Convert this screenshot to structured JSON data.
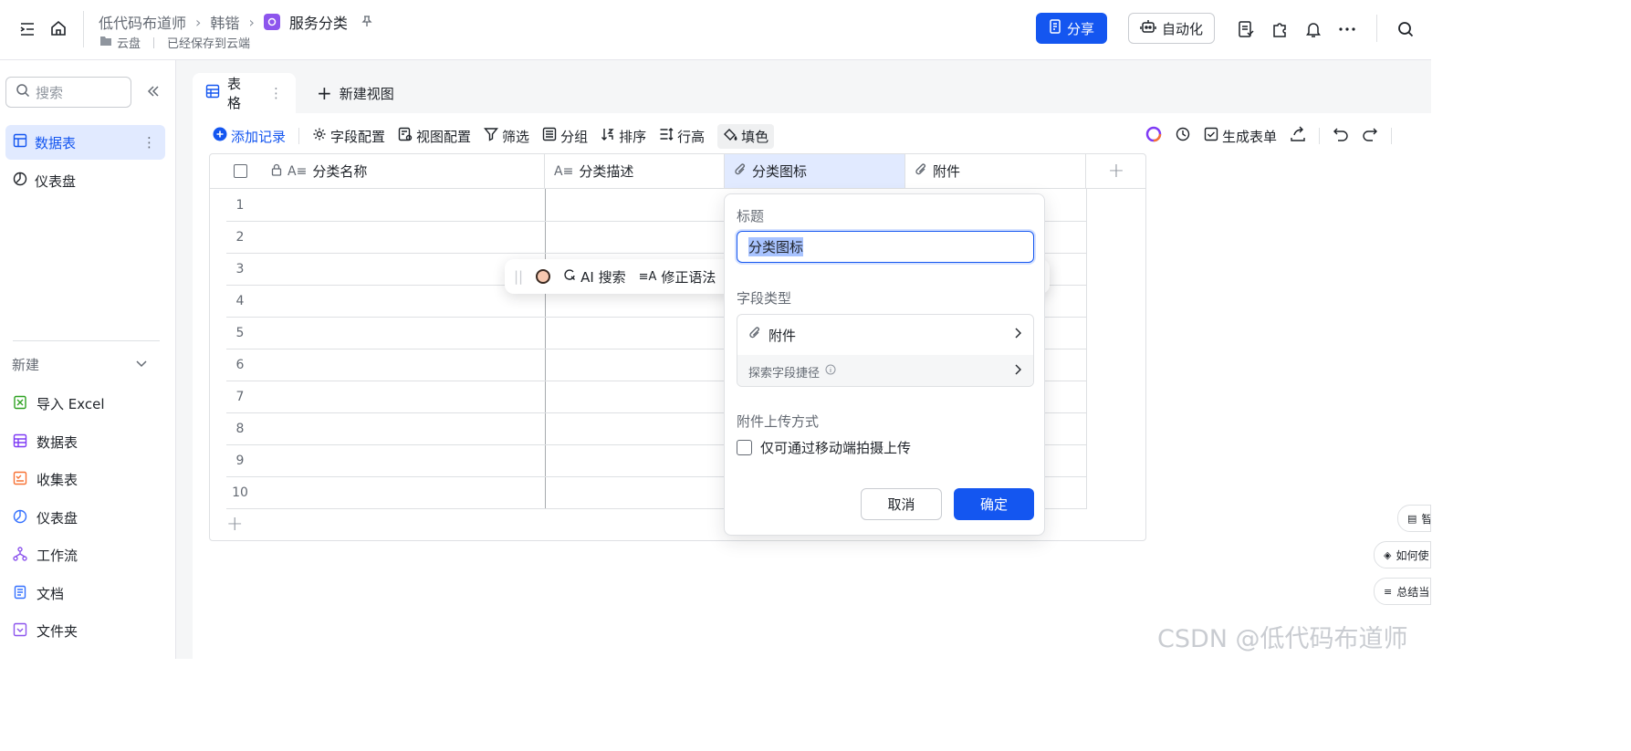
{
  "breadcrumb": {
    "root": "低代码布道师",
    "middle": "韩锴",
    "current": "服务分类"
  },
  "subline": {
    "location": "云盘",
    "status": "已经保存到云端"
  },
  "header": {
    "share_label": "分享",
    "automation_label": "自动化"
  },
  "sidebar": {
    "search_placeholder": "搜索",
    "items": [
      {
        "label": "数据表"
      },
      {
        "label": "仪表盘"
      }
    ],
    "new_section": "新建",
    "new_items": [
      {
        "label": "导入 Excel",
        "color": "#2ea121"
      },
      {
        "label": "数据表",
        "color": "#7f3bf5"
      },
      {
        "label": "收集表",
        "color": "#f77234"
      },
      {
        "label": "仪表盘",
        "color": "#3370ff"
      },
      {
        "label": "工作流",
        "color": "#8d55ed"
      },
      {
        "label": "文档",
        "color": "#3370ff"
      },
      {
        "label": "文件夹",
        "color": "#8d55ed"
      }
    ]
  },
  "tabs": [
    {
      "label": "表格"
    },
    {
      "label": "新建视图"
    }
  ],
  "toolbar": {
    "add_record": "添加记录",
    "field_config": "字段配置",
    "view_config": "视图配置",
    "filter": "筛选",
    "group": "分组",
    "sort": "排序",
    "row_height": "行高",
    "fill_color": "填色",
    "generate_form": "生成表单"
  },
  "table": {
    "columns": [
      {
        "label": "分类名称"
      },
      {
        "label": "分类描述"
      },
      {
        "label": "分类图标"
      },
      {
        "label": "附件"
      }
    ],
    "rows": [
      "1",
      "2",
      "3",
      "4",
      "5",
      "6",
      "7",
      "8",
      "9",
      "10"
    ]
  },
  "aibar": {
    "ai_search": "AI 搜索",
    "fix_grammar": "修正语法"
  },
  "popup": {
    "title_label": "标题",
    "title_value": "分类图标",
    "type_label": "字段类型",
    "type_value": "附件",
    "explore": "探索字段捷径",
    "upload_label": "附件上传方式",
    "checkbox_label": "仅可通过移动端拍摄上传",
    "cancel": "取消",
    "confirm": "确定"
  },
  "float_chips": [
    {
      "label": "智"
    },
    {
      "label": "如何使"
    },
    {
      "label": "总结当"
    }
  ],
  "watermark": "CSDN @低代码布道师",
  "colors": {
    "accent": "#1456f0",
    "selected_header": "#e1eaff"
  }
}
